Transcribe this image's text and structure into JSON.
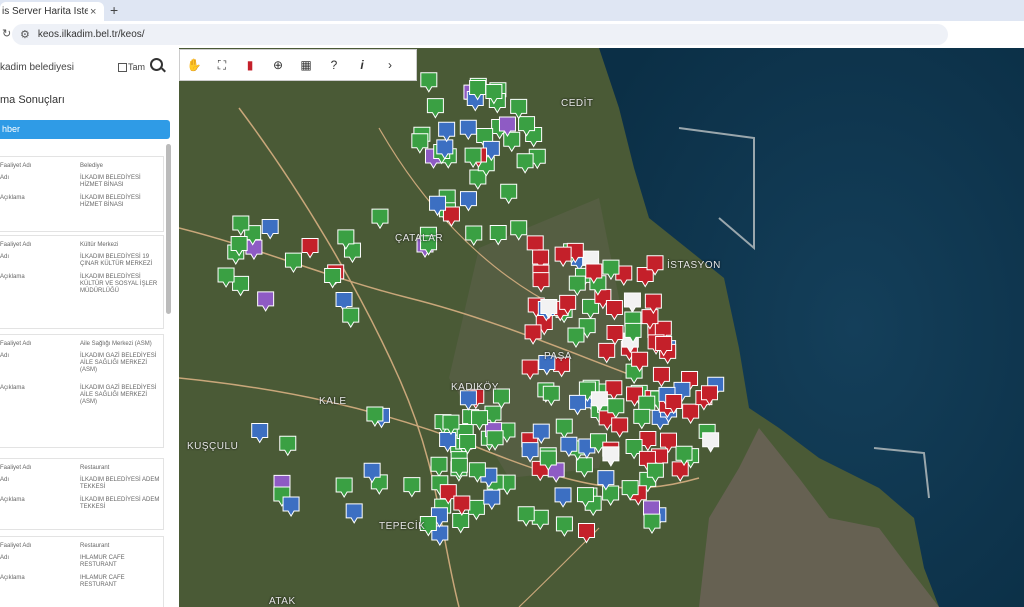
{
  "browser": {
    "tab_title": "is Server Harita İstemcisi",
    "tab_close": "×",
    "new_tab": "+",
    "url": "keos.ilkadim.bel.tr/keos/",
    "back": "↻"
  },
  "sidebar": {
    "search_value": "kadim belediyesi",
    "tam_label": "Tam",
    "results_title": "ma Sonuçları",
    "rehber_label": "hber",
    "cards": [
      {
        "rows": [
          {
            "k": "Faaliyet Adı",
            "v": "Belediye"
          },
          {
            "k": "Adı",
            "v": "İLKADIM BELEDİYESİ HİZMET BİNASI"
          },
          {
            "k": "Açıklama",
            "v": "İLKADIM BELEDİYESİ HİZMET BİNASI"
          }
        ]
      },
      {
        "rows": [
          {
            "k": "Faaliyet Adı",
            "v": "Kültür Merkezi"
          },
          {
            "k": "Adı",
            "v": "İLKADIM BELEDİYESİ 19 ÇINAR KÜLTÜR MERKEZİ"
          },
          {
            "k": "Açıklama",
            "v": "İLKADIM BELEDİYESİ KÜLTÜR VE SOSYAL İŞLER MÜDÜRLÜĞÜ"
          }
        ]
      },
      {
        "rows": [
          {
            "k": "Faaliyet Adı",
            "v": "Aile Sağlığı Merkezi (ASM)"
          },
          {
            "k": "Adı",
            "v": "İLKADIM GAZİ BELEDİYESİ AİLE SAĞLIĞI MERKEZİ (ASM)"
          },
          {
            "k": "Açıklama",
            "v": "İLKADIM GAZİ BELEDİYESİ AİLE SAĞLIĞI MERKEZİ (ASM)"
          }
        ]
      },
      {
        "rows": [
          {
            "k": "Faaliyet Adı",
            "v": "Restaurant"
          },
          {
            "k": "Adı",
            "v": "İLKADIM BELEDİYESİ ADEM TEKKESİ"
          },
          {
            "k": "Açıklama",
            "v": "İLKADIM BELEDİYESİ ADEM TEKKESİ"
          }
        ]
      },
      {
        "rows": [
          {
            "k": "Faaliyet Adı",
            "v": "Restaurant"
          },
          {
            "k": "Adı",
            "v": "IHLAMUR CAFE RESTURANT"
          },
          {
            "k": "Açıklama",
            "v": "IHLAMUR CAFE RESTURANT"
          }
        ]
      }
    ]
  },
  "map": {
    "labels": [
      "CEDİT",
      "ÇATALAR",
      "İSTASYON",
      "KADIKÖY",
      "KUŞÇULU",
      "TEPECİK",
      "KALE",
      "PAŞA",
      "ATAK"
    ]
  },
  "colors": {
    "sea": "#0f3b55",
    "land": "#4a5a36",
    "poi_green": "#3aa043",
    "poi_red": "#c4202a",
    "poi_blue": "#3c6fc2",
    "accent": "#2f9be6"
  }
}
